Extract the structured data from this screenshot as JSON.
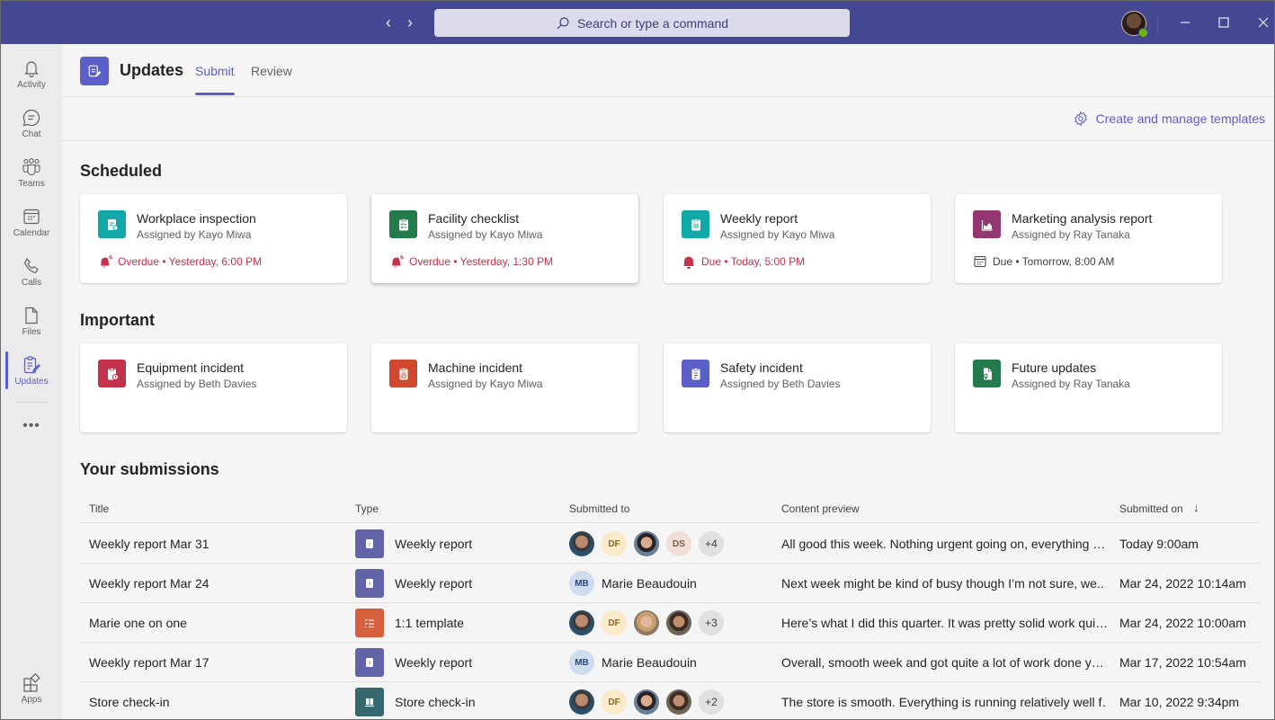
{
  "titlebar": {
    "back_label": "‹",
    "forward_label": "›",
    "search_placeholder": "Search or type a command",
    "minimize_label": "—",
    "maximize_label": "☐",
    "close_label": "✕",
    "presence": "available"
  },
  "rail": {
    "items": [
      {
        "label": "Activity",
        "icon": "bell-icon"
      },
      {
        "label": "Chat",
        "icon": "chat-icon"
      },
      {
        "label": "Teams",
        "icon": "teams-icon"
      },
      {
        "label": "Calendar",
        "icon": "calendar-icon"
      },
      {
        "label": "Calls",
        "icon": "phone-icon"
      },
      {
        "label": "Files",
        "icon": "file-icon"
      },
      {
        "label": "Updates",
        "icon": "updates-icon",
        "active": true
      }
    ],
    "more_label": "•••",
    "apps_label": "Apps"
  },
  "header": {
    "title": "Updates",
    "tabs": [
      {
        "label": "Submit",
        "active": true
      },
      {
        "label": "Review",
        "active": false
      }
    ],
    "templates_link": "Create and manage templates"
  },
  "scheduled": {
    "title": "Scheduled",
    "cards": [
      {
        "title": "Workplace inspection",
        "assigned": "Assigned by Kayo Miwa",
        "due": "Overdue • Yesterday, 6:00 PM",
        "due_status": "overdue",
        "color": "#13a8a8",
        "icon": "inspection-icon"
      },
      {
        "title": "Facility checklist",
        "assigned": "Assigned by Kayo Miwa",
        "due": "Overdue • Yesterday, 1:30 PM",
        "due_status": "overdue",
        "color": "#237b4b",
        "icon": "checklist-icon"
      },
      {
        "title": "Weekly report",
        "assigned": "Assigned by Kayo Miwa",
        "due": "Due • Today, 5:00 PM",
        "due_status": "due-today",
        "color": "#13a8a8",
        "icon": "report-icon"
      },
      {
        "title": "Marketing analysis report",
        "assigned": "Assigned by Ray Tanaka",
        "due": "Due • Tomorrow, 8:00 AM",
        "due_status": "upcoming",
        "color": "#943670",
        "icon": "chart-icon"
      }
    ]
  },
  "important": {
    "title": "Important",
    "cards": [
      {
        "title": "Equipment incident",
        "assigned": "Assigned by Beth Davies",
        "color": "#c4314b",
        "icon": "incident-icon"
      },
      {
        "title": "Machine incident",
        "assigned": "Assigned by Kayo Miwa",
        "color": "#d0492f",
        "icon": "machine-icon"
      },
      {
        "title": "Safety incident",
        "assigned": "Assigned by Beth Davies",
        "color": "#5b5fc7",
        "icon": "clipboard-icon"
      },
      {
        "title": "Future updates",
        "assigned": "Assigned by Ray Tanaka",
        "color": "#237b4b",
        "icon": "document-icon"
      }
    ]
  },
  "submissions": {
    "title": "Your submissions",
    "columns": [
      "Title",
      "Type",
      "Submitted to",
      "Content preview",
      "Submitted on"
    ],
    "sort_indicator": "↓",
    "rows": [
      {
        "title": "Weekly report Mar 31",
        "type": "Weekly report",
        "type_color": "#6264a7",
        "recipients": [
          "photo1",
          "DF",
          "photo2",
          "DS"
        ],
        "more": "+4",
        "preview": "All good this week. Nothing urgent going on, everything …",
        "date": "Today 9:00am"
      },
      {
        "title": "Weekly report Mar 24",
        "type": "Weekly report",
        "type_color": "#6264a7",
        "recipients": [
          "MB"
        ],
        "recipient_name": "Marie Beaudouin",
        "preview": "Next week might be kind of busy though I’m not sure, we..",
        "date": "Mar 24, 2022 10:14am"
      },
      {
        "title": "Marie one on one",
        "type": "1:1 template",
        "type_color": "#d65f3e",
        "recipients": [
          "photo1",
          "DF",
          "photo3",
          "photo4"
        ],
        "more": "+3",
        "preview": "Here’s what I did this quarter. It was pretty solid work qui…",
        "date": "Mar 24, 2022 10:00am"
      },
      {
        "title": "Weekly report Mar 17",
        "type": "Weekly report",
        "type_color": "#6264a7",
        "recipients": [
          "MB"
        ],
        "recipient_name": "Marie Beaudouin",
        "preview": "Overall, smooth week and got quite a lot of work done y…",
        "date": "Mar 17, 2022 10:54am"
      },
      {
        "title": "Store check-in",
        "type": "Store check-in",
        "type_color": "#37676e",
        "recipients": [
          "photo1",
          "DF",
          "photo2",
          "photo4"
        ],
        "more": "+2",
        "preview": "The store is smooth. Everything is running relatively well f…",
        "date": "Mar 10, 2022 9:34pm"
      }
    ]
  }
}
